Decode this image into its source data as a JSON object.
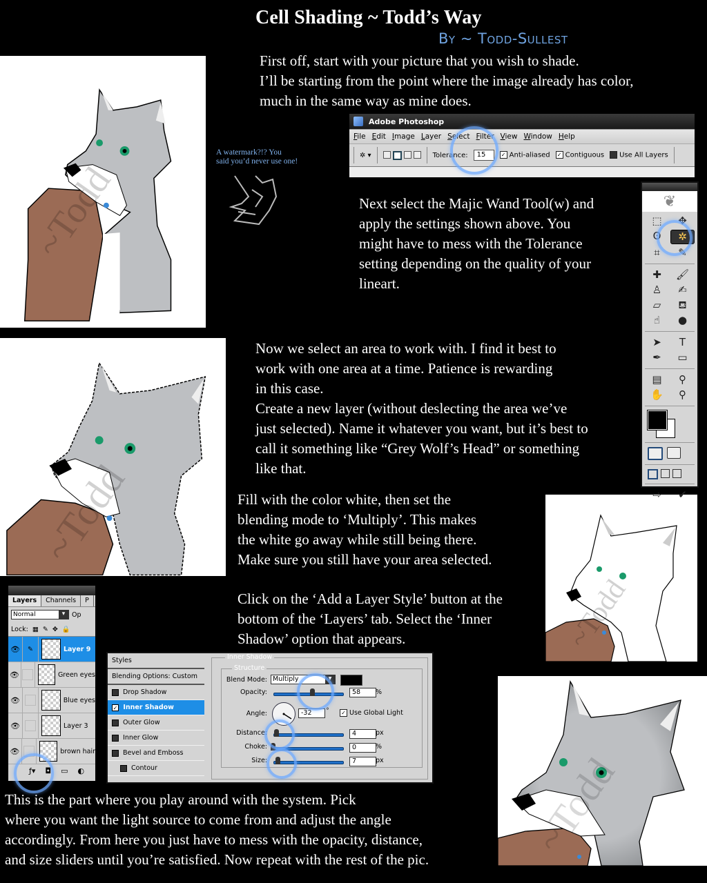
{
  "header": {
    "title": "Cell Shading ~ Todd’s Way",
    "byline": "By ~ Todd-Sullest"
  },
  "steps": {
    "step1": "First off, start with your picture that you wish to shade.\nI’ll be starting from the point where the image already has color,\nmuch in the same way as mine does.",
    "step2": "Next select the Majic Wand Tool(w) and\napply the settings shown above.  You\nmight have to mess with the Tolerance\nsetting depending on the quality of your\nlineart.",
    "step3": "Now we select an area to work with.  I find it best to\nwork with one area at a time.  Patience is rewarding\nin this case.\nCreate a new layer (without deslecting the area we’ve\njust selected). Name it whatever you want, but it’s best to\ncall it something like “Grey Wolf’s Head” or something\nlike that.",
    "step4": "Fill with the color white, then set the\nblending mode to ‘Multiply’.  This makes\nthe white go away while still being there.\nMake sure you still have your area selected.",
    "step5": "Click on the ‘Add a Layer Style’ button at the\nbottom of the ‘Layers’ tab.  Select the ‘Inner\nShadow’ option that appears.",
    "step6": "This is the part where you play around with the system.  Pick\nwhere you want the light source to come from and adjust the angle\naccordingly.  From here you just have to mess with the opacity, distance,\nand size sliders until you’re satisfied.  Now repeat with the rest of the pic."
  },
  "watermark_note": "A watermark?!?  You\nsaid you’d never use one!",
  "artwork": {
    "watermark_text": "~Todd",
    "colors": {
      "grey": "#b9bcbf",
      "brown": "#9b6b55",
      "eye_green": "#1a9a6a",
      "eye_blue": "#3a8ad8"
    }
  },
  "photoshop": {
    "app_title": "Adobe Photoshop",
    "menu": [
      "File",
      "Edit",
      "Image",
      "Layer",
      "Select",
      "Filter",
      "View",
      "Window",
      "Help"
    ],
    "options": {
      "tolerance_label": "Tolerance:",
      "tolerance_value": "15",
      "anti_aliased": "Anti-aliased",
      "contiguous": "Contiguous",
      "use_all_layers": "Use All Layers"
    },
    "highlight_color": "#6eaaff"
  },
  "layers_panel": {
    "tabs": [
      "Layers",
      "Channels",
      "P"
    ],
    "blend_mode": "Normal",
    "opacity_label": "Op",
    "lock_label": "Lock:",
    "layers": [
      {
        "name": "Layer 9",
        "selected": true
      },
      {
        "name": "Green eyes",
        "selected": false
      },
      {
        "name": "Blue eyes",
        "selected": false
      },
      {
        "name": "Layer 3",
        "selected": false
      },
      {
        "name": "brown hair",
        "selected": false
      }
    ]
  },
  "layer_style": {
    "styles_header": "Styles",
    "blending_options": "Blending Options: Custom",
    "items": [
      "Drop Shadow",
      "Inner Shadow",
      "Outer Glow",
      "Inner Glow",
      "Bevel and Emboss",
      "Contour"
    ],
    "selected": "Inner Shadow",
    "section_title": "Inner Shadow",
    "structure_title": "Structure",
    "blend_mode_label": "Blend Mode:",
    "blend_mode": "Multiply",
    "opacity_label": "Opacity:",
    "opacity": "58",
    "opacity_unit": "%",
    "angle_label": "Angle:",
    "angle": "-32",
    "angle_unit": "°",
    "use_global_light": "Use Global Light",
    "distance_label": "Distance:",
    "distance": "4",
    "distance_unit": "px",
    "choke_label": "Choke:",
    "choke": "0",
    "choke_unit": "%",
    "size_label": "Size:",
    "size": "7",
    "size_unit": "px"
  }
}
